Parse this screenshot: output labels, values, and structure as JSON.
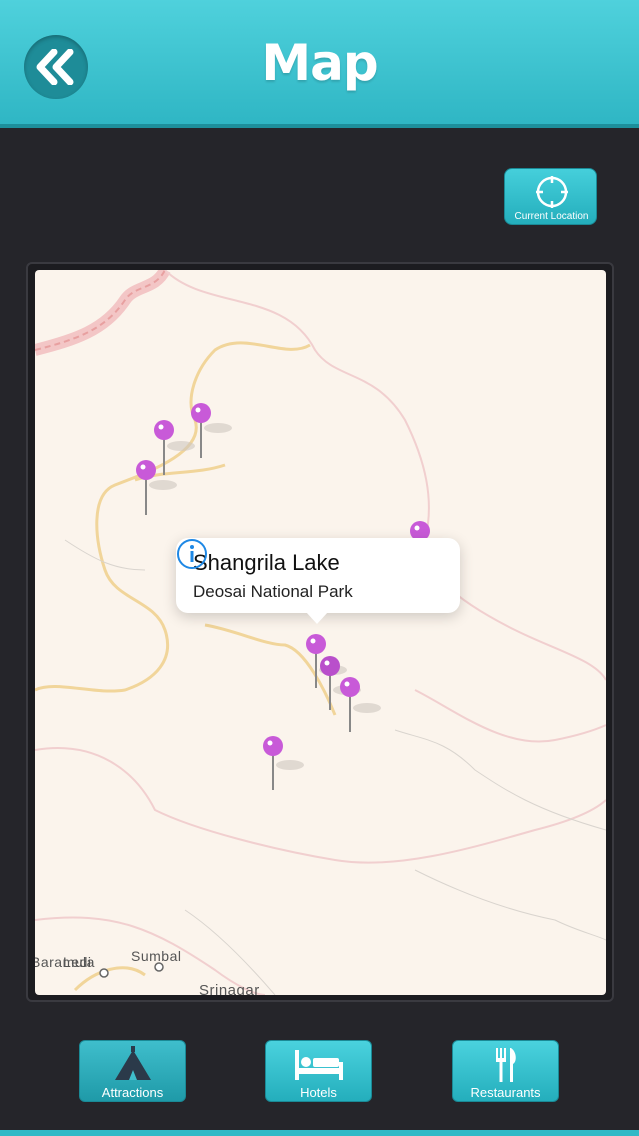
{
  "header": {
    "title": "Map",
    "back_icon": "double-chevron-left-icon"
  },
  "location_button": {
    "label": "Current Location",
    "icon": "crosshair-icon"
  },
  "map": {
    "callout": {
      "title": "Shangrila Lake",
      "subtitle": "Deosai National Park",
      "icon": "info-icon"
    },
    "places": [
      "Baramula",
      "Ledi",
      "Sumbal",
      "Srinagar"
    ],
    "pin_color": "#c85ad8"
  },
  "tabs": [
    {
      "label": "Attractions",
      "icon": "tent-icon",
      "active": true
    },
    {
      "label": "Hotels",
      "icon": "bed-icon",
      "active": false
    },
    {
      "label": "Restaurants",
      "icon": "fork-knife-icon",
      "active": false
    }
  ],
  "colors": {
    "accent": "#3cc6d3",
    "background": "#25252a"
  }
}
